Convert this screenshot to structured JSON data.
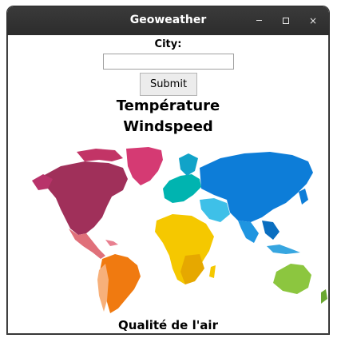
{
  "window": {
    "title": "Geoweather",
    "controls": {
      "minimize": "minimize-icon",
      "maximize": "maximize-icon",
      "close": "close-icon",
      "close_glyph": "×"
    }
  },
  "form": {
    "city_label": "City:",
    "city_value": "",
    "submit_label": "Submit"
  },
  "sections": {
    "temperature": "Température",
    "windspeed": "Windspeed",
    "air_quality": "Qualité de l'air"
  },
  "map": {
    "icon": "world-map-image",
    "colors": {
      "north_america": "#a0305a",
      "greenland": "#d53a73",
      "central_america": "#e0707a",
      "south_america": "#f07a10",
      "africa": "#f5c800",
      "europe": "#00b4b0",
      "asia": "#0d7dd8",
      "oceania": "#8cc63f"
    }
  }
}
